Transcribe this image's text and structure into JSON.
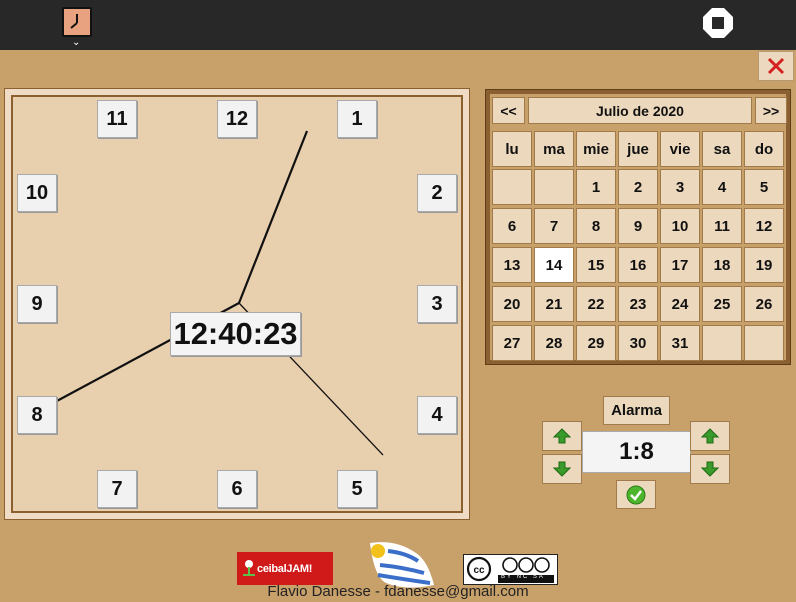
{
  "topbar": {
    "activity_icon": "clock-icon",
    "tray_arrow": "⌄",
    "stop_icon": "stop-icon"
  },
  "close_icon": "close-x-icon",
  "clock": {
    "hours": [
      "1",
      "2",
      "3",
      "4",
      "5",
      "6",
      "7",
      "8",
      "9",
      "10",
      "11",
      "12"
    ],
    "digital_time": "12:40:23"
  },
  "calendar": {
    "prev_label": "<<",
    "next_label": ">>",
    "month_title": "Julio de 2020",
    "weekdays": [
      "lu",
      "ma",
      "mie",
      "jue",
      "vie",
      "sa",
      "do"
    ],
    "weeks": [
      [
        "",
        "",
        "1",
        "2",
        "3",
        "4",
        "5"
      ],
      [
        "6",
        "7",
        "8",
        "9",
        "10",
        "11",
        "12"
      ],
      [
        "13",
        "14",
        "15",
        "16",
        "17",
        "18",
        "19"
      ],
      [
        "20",
        "21",
        "22",
        "23",
        "24",
        "25",
        "26"
      ],
      [
        "27",
        "28",
        "29",
        "30",
        "31",
        "",
        ""
      ]
    ],
    "selected_day": "14"
  },
  "alarm": {
    "label": "Alarma",
    "value": "1:8",
    "up_icon": "arrow-up-icon",
    "down_icon": "arrow-down-icon",
    "confirm_icon": "check-icon"
  },
  "footer": {
    "ceibal_logo_text": "ceibalJAM!",
    "flag_icon": "uruguay-flag-icon",
    "license_text": "BY NC SA",
    "credits": "Flavio Danesse - fdanesse@gmail.com"
  },
  "colors": {
    "background": "#c8a06a",
    "topbar": "#282828",
    "clock_face": "#e8cfae",
    "close_red": "#d42020",
    "arrow_green": "#3a9a2a"
  }
}
